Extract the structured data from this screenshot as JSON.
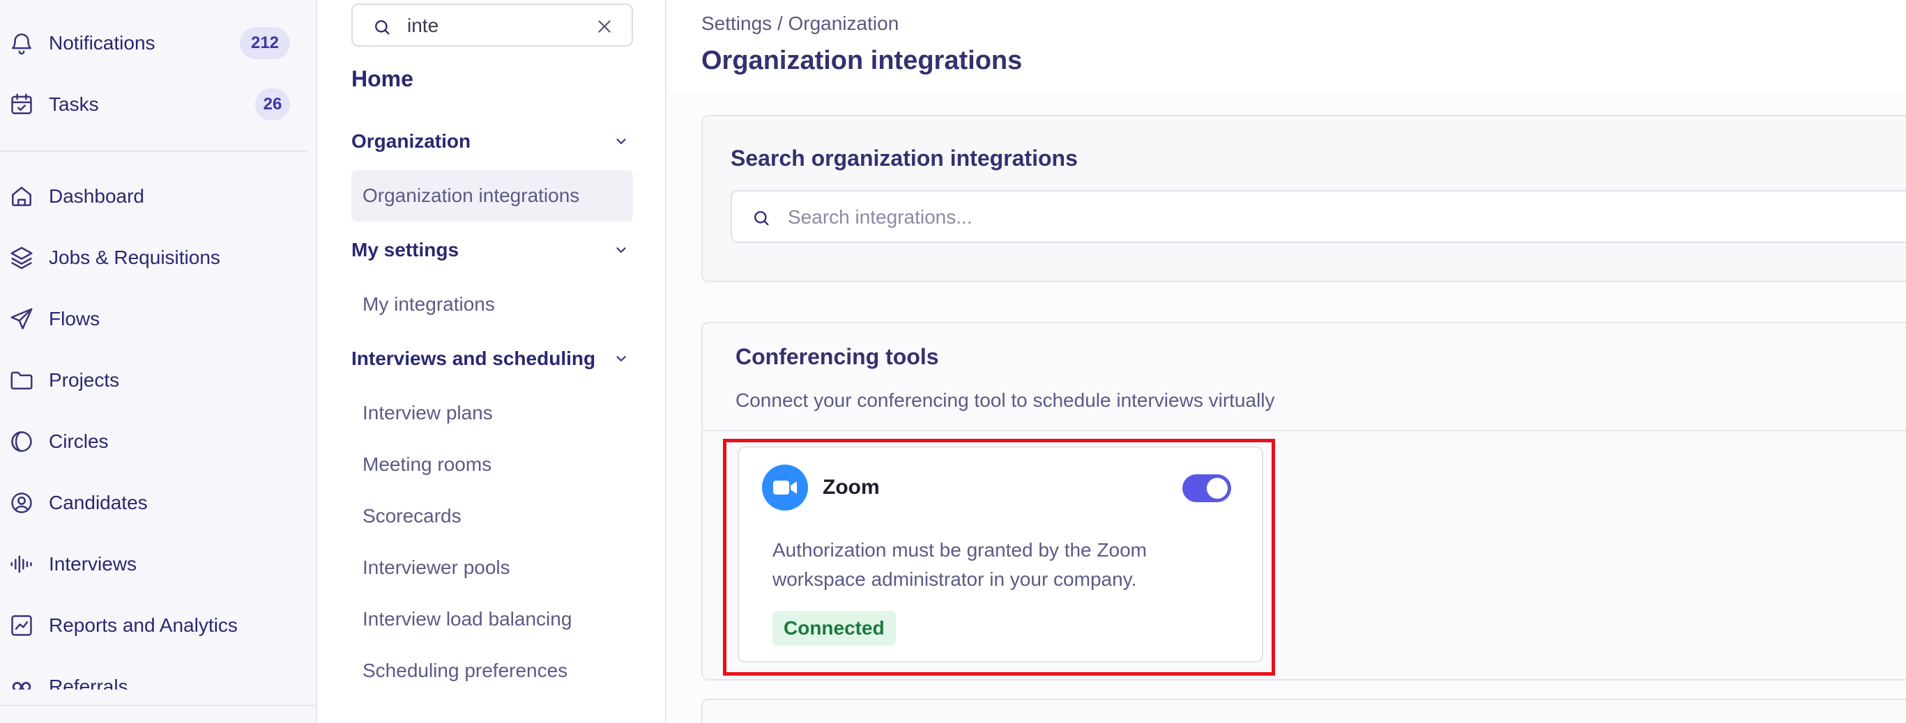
{
  "left_nav": {
    "notifications": {
      "label": "Notifications",
      "count": "212",
      "icon": "bell-icon"
    },
    "tasks": {
      "label": "Tasks",
      "count": "26",
      "icon": "calendar-check-icon"
    },
    "items": [
      {
        "label": "Dashboard",
        "icon": "home-icon"
      },
      {
        "label": "Jobs & Requisitions",
        "icon": "layers-icon"
      },
      {
        "label": "Flows",
        "icon": "send-icon"
      },
      {
        "label": "Projects",
        "icon": "folder-icon"
      },
      {
        "label": "Circles",
        "icon": "circles-icon"
      },
      {
        "label": "Candidates",
        "icon": "user-circle-icon"
      },
      {
        "label": "Interviews",
        "icon": "audio-wave-icon"
      },
      {
        "label": "Reports and Analytics",
        "icon": "chart-icon"
      },
      {
        "label": "Referrals",
        "icon": "referral-icon"
      }
    ]
  },
  "settings_sidebar": {
    "search": {
      "value": "inte"
    },
    "home": "Home",
    "groups": [
      {
        "label": "Organization",
        "items": [
          "Organization integrations"
        ]
      },
      {
        "label": "My settings",
        "items": [
          "My integrations"
        ]
      },
      {
        "label": "Interviews and scheduling",
        "items": [
          "Interview plans",
          "Meeting rooms",
          "Scorecards",
          "Interviewer pools",
          "Interview load balancing",
          "Scheduling preferences"
        ]
      }
    ],
    "active_item": "Organization integrations"
  },
  "main": {
    "breadcrumb": "Settings / Organization",
    "title": "Organization integrations",
    "search_section": {
      "title": "Search organization integrations",
      "placeholder": "Search integrations..."
    },
    "conferencing": {
      "title": "Conferencing tools",
      "description": "Connect your conferencing tool to schedule interviews virtually",
      "zoom": {
        "name": "Zoom",
        "description": "Authorization must be granted by the Zoom workspace administrator in your company.",
        "status": "Connected",
        "enabled": true
      }
    }
  },
  "colors": {
    "accent": "#5b57e6",
    "zoom_blue": "#2d8cff",
    "connected_bg": "#e2f5e9",
    "connected_text": "#1a7a3c",
    "highlight": "#e8101a"
  }
}
